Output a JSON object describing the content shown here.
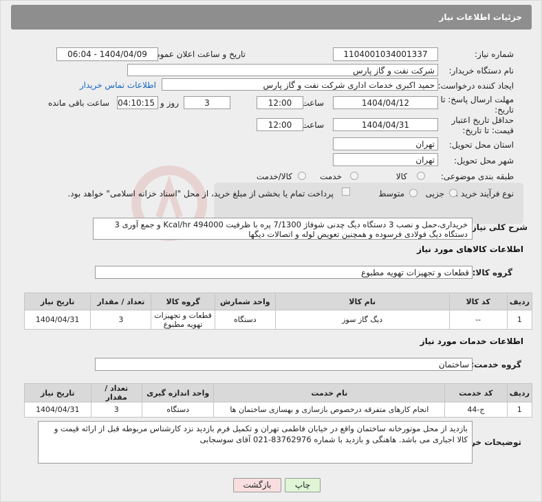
{
  "header": {
    "title": "جزئیات اطلاعات نیاز"
  },
  "form": {
    "need_number_label": "شماره نیاز:",
    "need_number": "1104001034001337",
    "announce_label": "تاریخ و ساعت اعلان عمومی:",
    "announce_value": "1404/04/09 - 06:04",
    "buyer_org_label": "نام دستگاه خریدار:",
    "buyer_org": "شرکت نفت و گاز پارس",
    "creator_label": "ایجاد کننده درخواست:",
    "creator": "حمید اکبری خدمات اداری  شرکت نفت و گاز پارس",
    "contact_link": "اطلاعات تماس خریدار",
    "deadline_label": "مهلت ارسال پاسخ: تا تاریخ:",
    "deadline_date": "1404/04/12",
    "time_label": "ساعت",
    "deadline_time": "12:00",
    "days_value": "3",
    "days_label": "روز و",
    "remaining_value": "04:10:15",
    "remaining_label": "ساعت باقی مانده",
    "validity_label": "حداقل تاریخ اعتبار قیمت: تا تاریخ:",
    "validity_date": "1404/04/31",
    "validity_time": "12:00",
    "province_label": "استان محل تحویل:",
    "province": "تهران",
    "city_label": "شهر محل تحویل:",
    "city": "تهران",
    "category_label": "طبقه بندی موضوعی:",
    "category_options": [
      "کالا",
      "خدمت",
      "کالا/خدمت"
    ],
    "process_label": "نوع فرآیند خرید :",
    "process_options": [
      "جزیی",
      "متوسط"
    ],
    "payment_note": "پرداخت تمام یا بخشی از مبلغ خرید، از محل \"اسناد خزانه اسلامی\" خواهد بود.",
    "desc_label": "شرح کلی نیاز:",
    "desc_text": "خریداری،حمل و نصب 3 دستگاه دیگ چدنی شوفاژ 7/1300 پره با ظرفیت Kcal/hr 494000 و جمع آوری 3 دستگاه دیگ فولادی فرسوده و همچنین تعویض لوله و اتصالات دیگها"
  },
  "goods": {
    "section_title": "اطلاعات کالاهای مورد نیاز",
    "group_label": "گروه کالا:",
    "group_value": "قطعات و تجهیزات تهویه مطبوع",
    "headers": [
      "ردیف",
      "کد کالا",
      "نام کالا",
      "واحد شمارش",
      "گروه کالا",
      "تعداد / مقدار",
      "تاریخ نیاز"
    ],
    "rows": [
      [
        "1",
        "--",
        "دیگ گاز سوز",
        "دستگاه",
        "قطعات و تجهیزات تهویه مطبوع",
        "3",
        "1404/04/31"
      ]
    ]
  },
  "services": {
    "section_title": "اطلاعات خدمات مورد نیاز",
    "group_label": "گروه خدمت:",
    "group_value": "ساختمان",
    "headers": [
      "ردیف",
      "کد خدمت",
      "نام خدمت",
      "واحد اندازه گیری",
      "تعداد / مقدار",
      "تاریخ نیاز"
    ],
    "rows": [
      [
        "1",
        "ج-44",
        "انجام کارهای متفرقه درخصوص بازسازی و بهسازی ساختمان ها",
        "دستگاه",
        "3",
        "1404/04/31"
      ]
    ]
  },
  "notes": {
    "label": "توضیحات خریدار:",
    "text": "بازدید از محل موتورخانه ساختمان واقع در خیابان فاطمی تهران و تکمیل فرم بازدید نزد کارشناس مربوطه قبل از ارائه قیمت و کالا اجباری می باشد. هاهنگی و بازدید با شماره 83762976-021 آقای سوسجابی"
  },
  "buttons": {
    "print": "چاپ",
    "back": "بازگشت"
  },
  "colors": {
    "titlebar": "#8e8e8e",
    "link": "#1565c0",
    "print_btn": "#dff5d6",
    "back_btn": "#f8dede"
  }
}
